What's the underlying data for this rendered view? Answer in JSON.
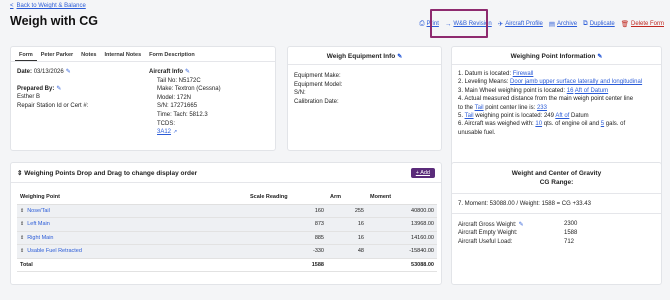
{
  "nav": {
    "back_label": "Back to Weight & Balance"
  },
  "page": {
    "title": "Weigh with CG"
  },
  "actions": {
    "print": "Print",
    "wb_revision": "W&B Revision",
    "aircraft_profile": "Aircraft Profile",
    "archive": "Archive",
    "duplicate": "Duplicate",
    "delete_form": "Delete Form"
  },
  "form_card": {
    "tabs": [
      "Form",
      "Peter Parker",
      "Notes",
      "Internal Notes",
      "Form Description"
    ],
    "date_label": "Date:",
    "date_value": "03/13/2026",
    "prepared_by_label": "Prepared By:",
    "prepared_by_name": "Esther B",
    "repair_station": "Repair Station Id or Cert #:",
    "aircraft_info_label": "Aircraft Info",
    "tail_no": "Tail No: N5172C",
    "make": "Make: Textron (Cessna)",
    "model": "Model: 172N",
    "sn": "S/N: 17271665",
    "time": "Time: Tach: 5812.3",
    "tcds_label": "TCDS:",
    "tcds_link": "3A12"
  },
  "equipment_card": {
    "title": "Weigh Equipment Info",
    "make": "Equipment Make:",
    "model": "Equipment Model:",
    "sn": "S/N:",
    "calibration": "Calibration Date:"
  },
  "weighing_info": {
    "title": "Weighing Point Information",
    "l1_pre": "1. Datum is located: ",
    "l1_link": "Firewall",
    "l2_pre": "2. Leveling Means: ",
    "l2_link": "Door jamb upper surface laterally and longitudinal",
    "l3_pre": "3. Main Wheel weighing point is located: ",
    "l3_link": "16",
    "l3_mid": " ",
    "l3_link2": "Aft of Datum",
    "l4a": "4. Actual measured distance from the main weigh point center line",
    "l4b_pre": "to the ",
    "l4b_link": "Tail",
    "l4b_mid": " point center line is: ",
    "l4b_link2": "233",
    "l5_pre": "5. ",
    "l5_link": "Tail",
    "l5_mid": " weighing point is located: 249 ",
    "l5_link2": "Aft of",
    "l5_post": " Datum",
    "l6_pre": "6. Aircraft was weighed with: ",
    "l6_link": "10",
    "l6_mid": " qts. of engine oil and ",
    "l6_link2": "5",
    "l6_post": " gals. of",
    "l7": "unusable fuel."
  },
  "points_card": {
    "title": "Weighing Points Drop and Drag to change display order",
    "add_label": "+ Add",
    "columns": [
      "Weighing Point",
      "Scale Reading",
      "Arm",
      "Moment"
    ],
    "rows": [
      {
        "name": "Nose/Tail",
        "reading": "160",
        "arm": "255",
        "moment": "40800.00"
      },
      {
        "name": "Left Main",
        "reading": "873",
        "arm": "16",
        "moment": "13968.00"
      },
      {
        "name": "Right Main",
        "reading": "885",
        "arm": "16",
        "moment": "14160.00"
      },
      {
        "name": "Usable Fuel Retracted",
        "reading": "-330",
        "arm": "48",
        "moment": "-15840.00"
      }
    ],
    "total": {
      "label": "Total",
      "reading": "1588",
      "arm": "",
      "moment": "53088.00"
    }
  },
  "cg_card": {
    "title_line1": "Weight and Center of Gravity",
    "title_line2": "CG Range:",
    "moment_line": "7. Moment: 53088.00 / Weight: 1588 = CG +33.43",
    "gross_label": "Aircraft Gross Weight:",
    "gross_value": "2300",
    "empty_label": "Aircraft Empty Weight:",
    "empty_value": "1588",
    "useful_label": "Aircraft Useful Load:",
    "useful_value": "712"
  }
}
